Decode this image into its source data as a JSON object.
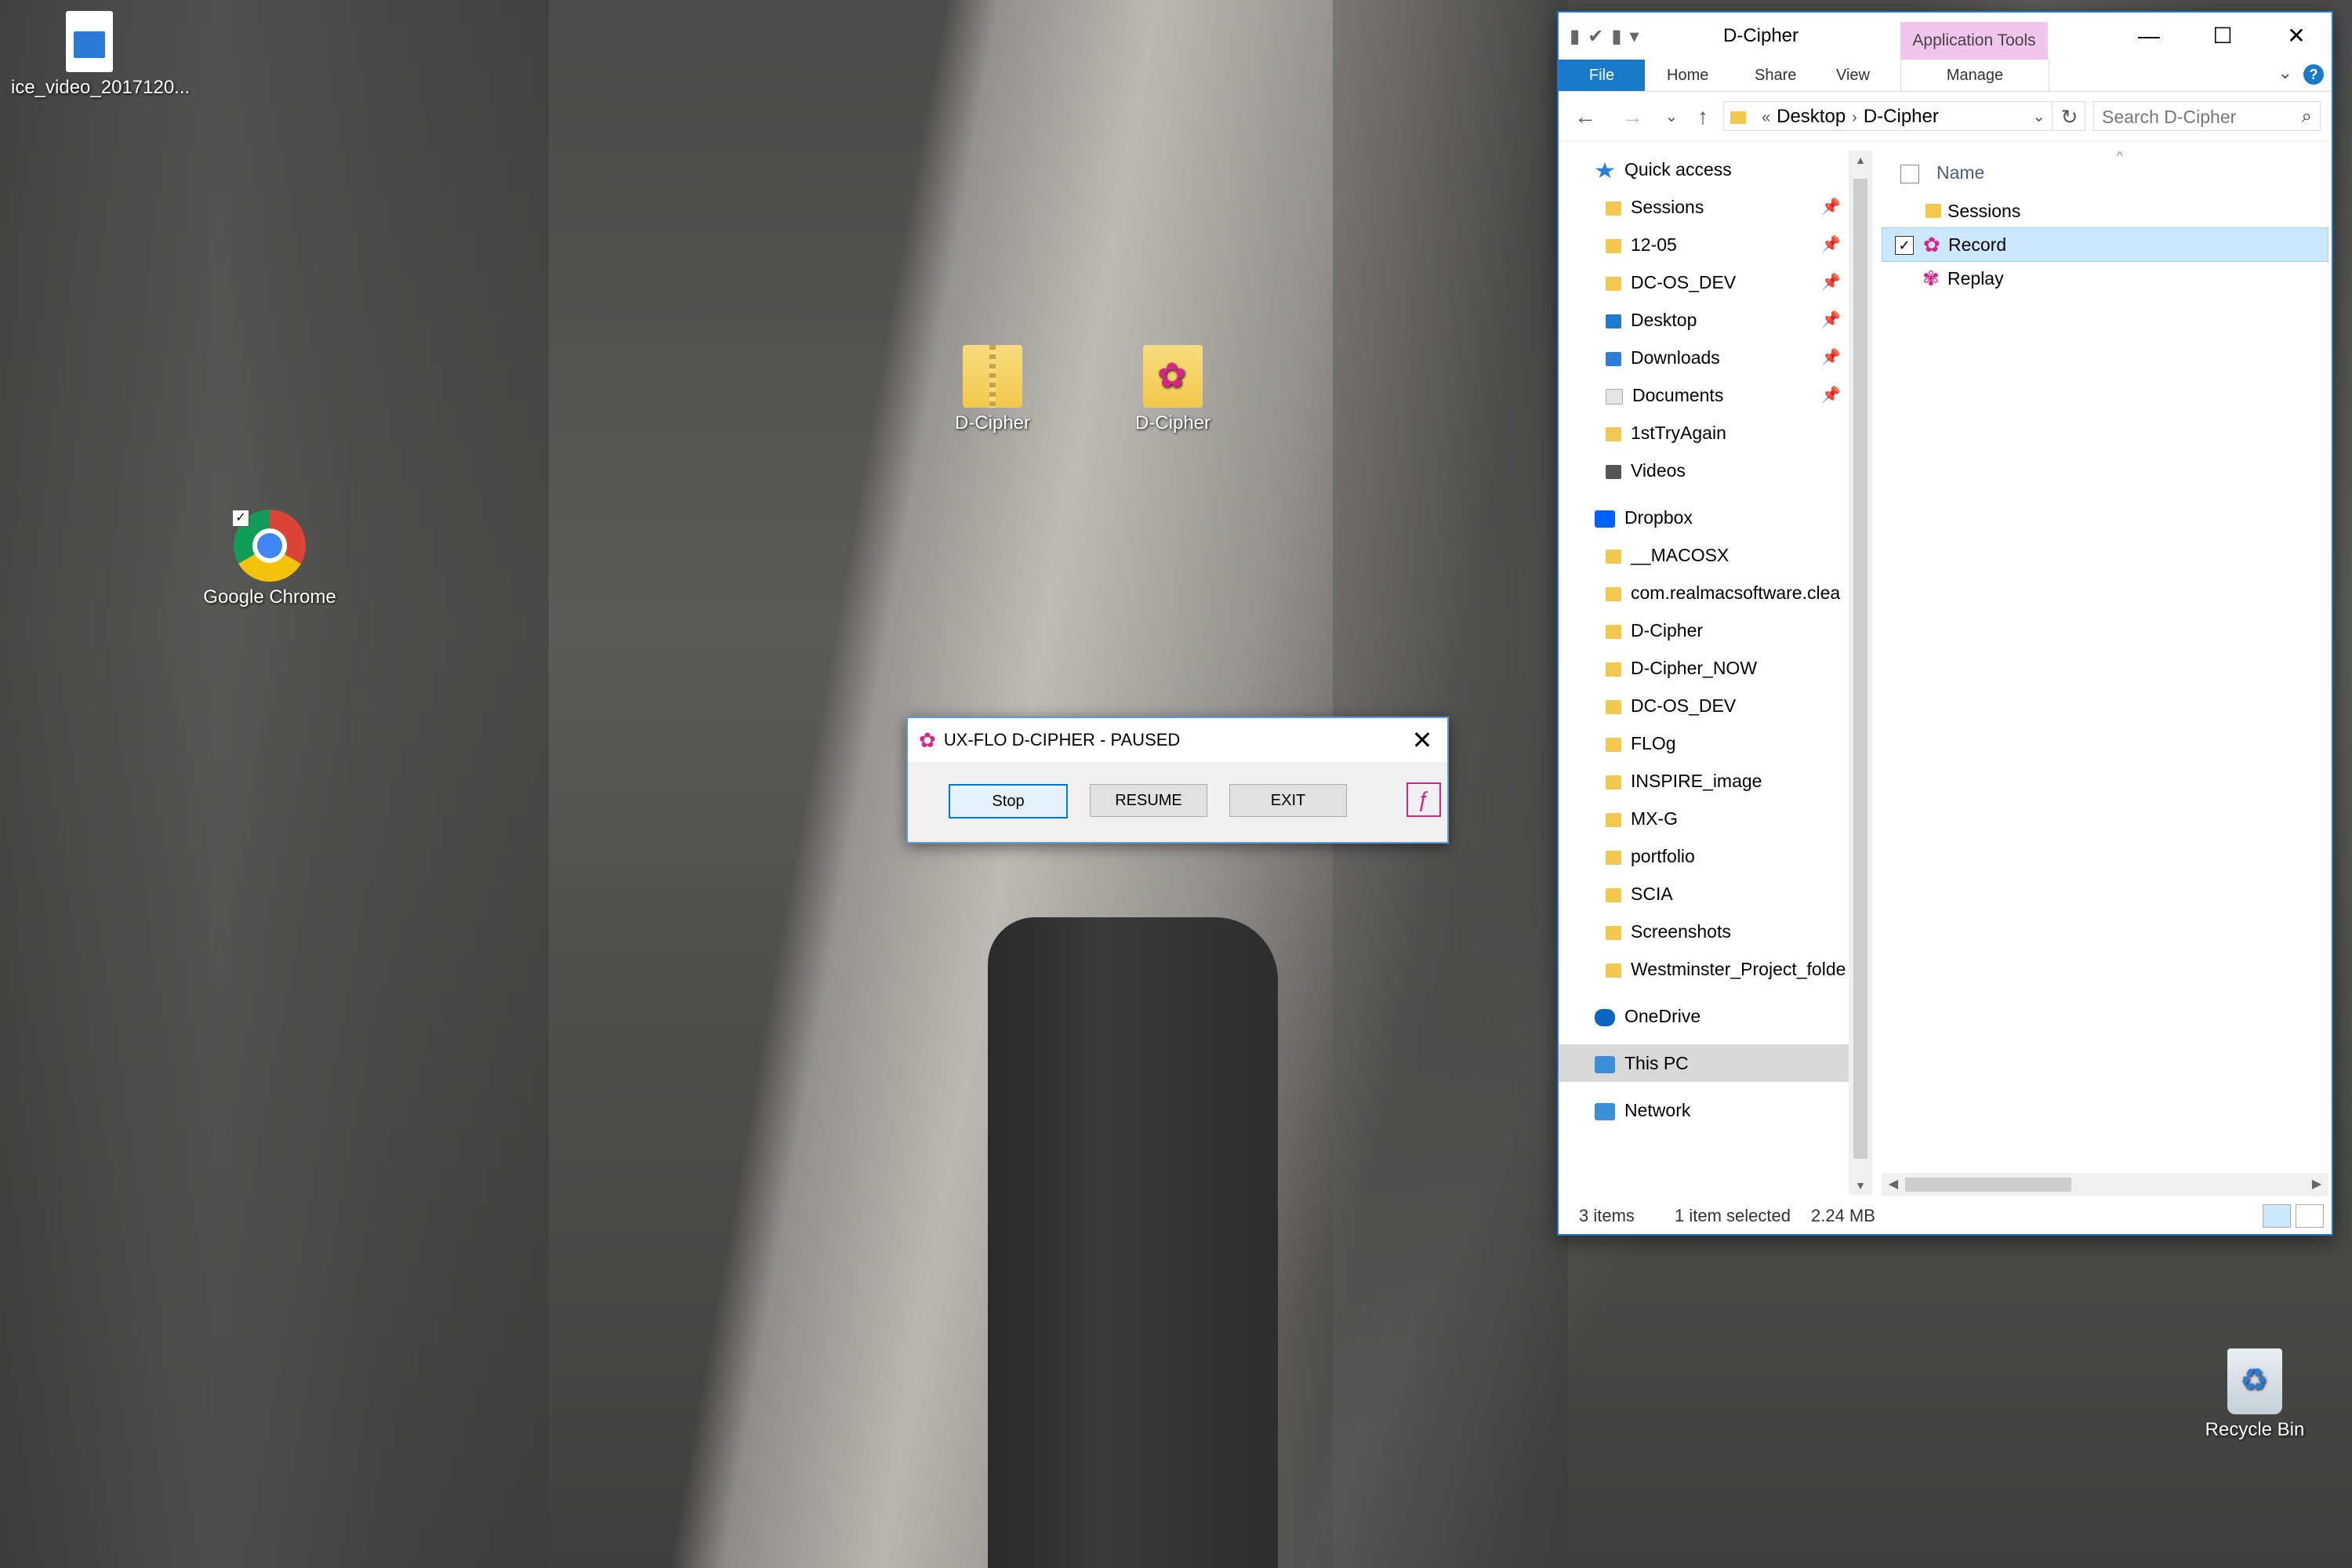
{
  "desktop": {
    "icons": {
      "video": "ice_video_2017120...",
      "zip": "D-Cipher",
      "dcipher": "D-Cipher",
      "chrome": "Google Chrome",
      "bin": "Recycle Bin"
    }
  },
  "dialog": {
    "title": "UX-FLO D-CIPHER - PAUSED",
    "buttons": {
      "stop": "Stop",
      "resume": "RESUME",
      "exit": "EXIT"
    }
  },
  "explorer": {
    "title": "D-Cipher",
    "context_tab_header": "Application Tools",
    "ribbon_tabs": {
      "file": "File",
      "home": "Home",
      "share": "Share",
      "view": "View",
      "manage": "Manage"
    },
    "address": {
      "overflow": "«",
      "segments": [
        "Desktop",
        "D-Cipher"
      ]
    },
    "search_placeholder": "Search D-Cipher",
    "nav": {
      "quick_access": "Quick access",
      "quick_items": [
        "Sessions",
        "12-05",
        "DC-OS_DEV",
        "Desktop",
        "Downloads",
        "Documents",
        "1stTryAgain",
        "Videos"
      ],
      "dropbox": "Dropbox",
      "dropbox_items": [
        "__MACOSX",
        "com.realmacsoftware.clea",
        "D-Cipher",
        "D-Cipher_NOW",
        "DC-OS_DEV",
        "FLOg",
        "INSPIRE_image",
        "MX-G",
        "portfolio",
        "SCIA",
        "Screenshots",
        "Westminster_Project_folde"
      ],
      "onedrive": "OneDrive",
      "this_pc": "This PC",
      "network": "Network"
    },
    "column_header": "Name",
    "files": [
      {
        "name": "Sessions",
        "type": "folder"
      },
      {
        "name": "Record",
        "type": "app",
        "selected": true
      },
      {
        "name": "Replay",
        "type": "app"
      }
    ],
    "status": {
      "count": "3 items",
      "selection": "1 item selected",
      "size": "2.24 MB"
    }
  },
  "colors": {
    "accent": "#1979ca",
    "brand_pink": "#d6248a",
    "selection": "#cce8ff"
  }
}
